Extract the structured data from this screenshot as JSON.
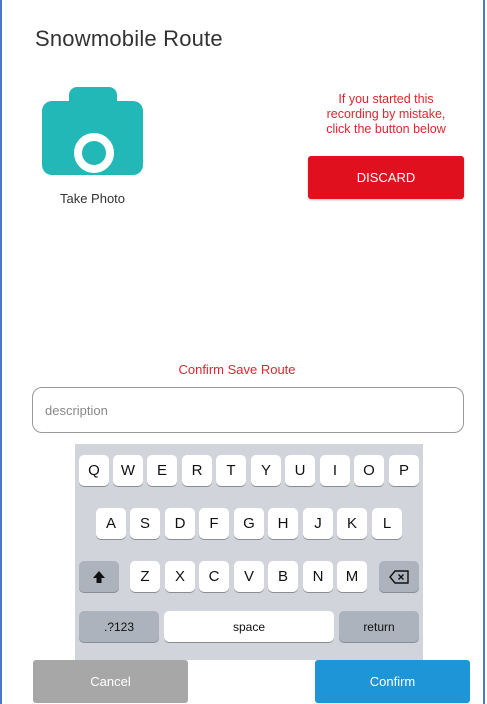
{
  "screen": {
    "title": "Snowmobile Route"
  },
  "photo": {
    "label": "Take Photo",
    "icon": "camera-icon",
    "icon_color": "#22b8b8"
  },
  "discard": {
    "note_lines": [
      "If you started this",
      "recording by mistake,",
      "click the button below"
    ],
    "button_label": "DISCARD",
    "button_color": "#e1101f"
  },
  "confirm": {
    "heading": "Confirm Save Route"
  },
  "description": {
    "placeholder": "description",
    "value": ""
  },
  "keyboard": {
    "row1": [
      "Q",
      "W",
      "E",
      "R",
      "T",
      "Y",
      "U",
      "I",
      "O",
      "P"
    ],
    "row2": [
      "A",
      "S",
      "D",
      "F",
      "G",
      "H",
      "J",
      "K",
      "L"
    ],
    "row3": [
      "Z",
      "X",
      "C",
      "V",
      "B",
      "N",
      "M"
    ],
    "shift_icon": "shift-arrow-icon",
    "backspace_icon": "backspace-icon",
    "numbers_label": ".?123",
    "space_label": "space",
    "return_label": "return"
  },
  "actions": {
    "cancel_label": "Cancel",
    "confirm_label": "Confirm",
    "confirm_color": "#1d95d6",
    "cancel_color": "#a7a7a7"
  }
}
